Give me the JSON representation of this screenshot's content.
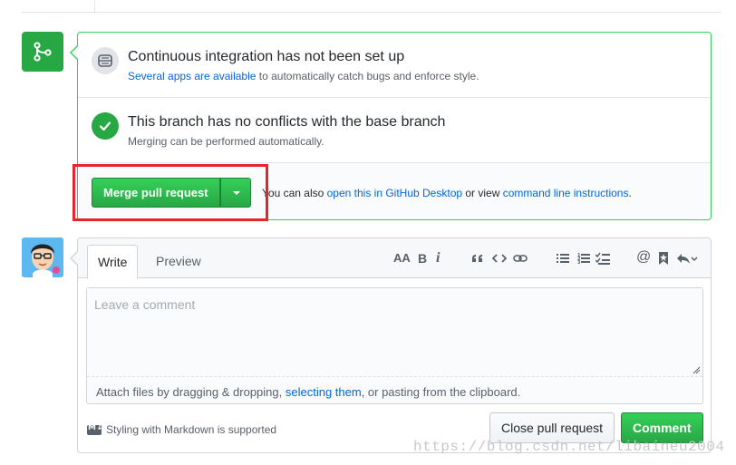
{
  "colors": {
    "success": "#28a745",
    "link": "#0366d6",
    "highlight": "#e8232a",
    "border": "#d1d5da"
  },
  "merge_box": {
    "ci": {
      "title": "Continuous integration has not been set up",
      "desc_link": "Several apps are available",
      "desc_rest": " to automatically catch bugs and enforce style."
    },
    "conflicts": {
      "title": "This branch has no conflicts with the base branch",
      "desc": "Merging can be performed automatically."
    },
    "actions": {
      "merge_label": "Merge pull request",
      "alt_prefix": "You can also ",
      "alt_link_desktop": "open this in GitHub Desktop",
      "alt_mid": " or view ",
      "alt_link_cli": "command line instructions",
      "alt_suffix": "."
    }
  },
  "comment": {
    "tabs": [
      "Write",
      "Preview"
    ],
    "toolbar": {
      "header": "AA",
      "bold": "B",
      "italic": "i",
      "mention": "@"
    },
    "placeholder": "Leave a comment",
    "attach_prefix": "Attach files by dragging & dropping, ",
    "attach_link": "selecting them",
    "attach_suffix": ", or pasting from the clipboard.",
    "markdown_icon_text": "M↓",
    "markdown_note": "Styling with Markdown is supported",
    "close_label": "Close pull request",
    "comment_label": "Comment"
  },
  "watermark": "https://blog.csdn.net/libaineu2004"
}
